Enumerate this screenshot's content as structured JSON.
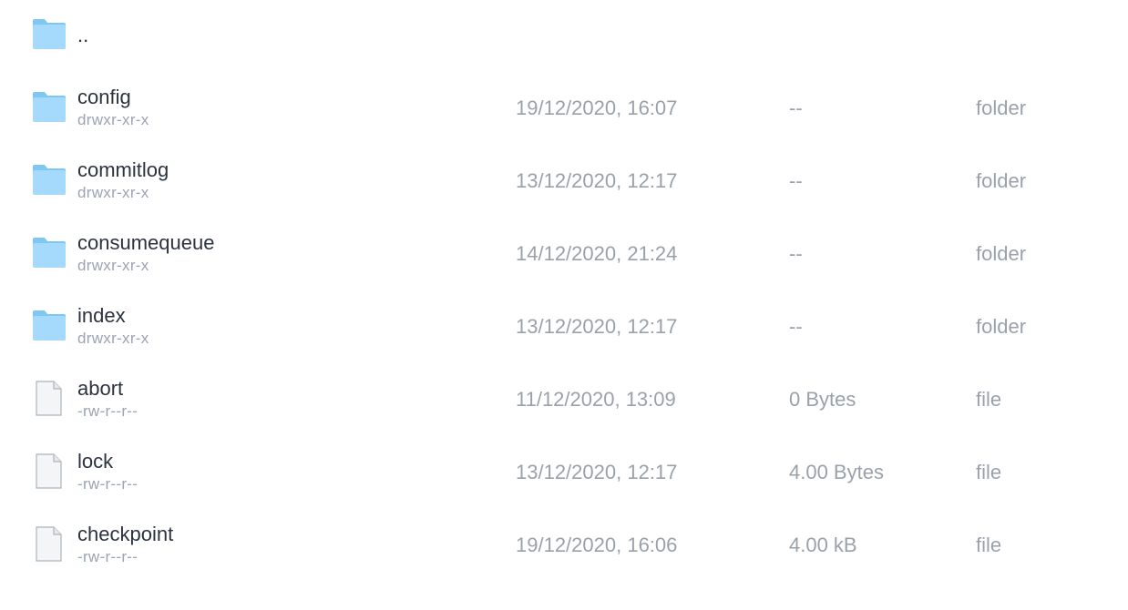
{
  "parent_row": {
    "name": "..",
    "icon": "folder-icon"
  },
  "entries": [
    {
      "name": "config",
      "permissions": "drwxr-xr-x",
      "modified": "19/12/2020, 16:07",
      "size": "--",
      "type": "folder",
      "icon": "folder-icon"
    },
    {
      "name": "commitlog",
      "permissions": "drwxr-xr-x",
      "modified": "13/12/2020, 12:17",
      "size": "--",
      "type": "folder",
      "icon": "folder-icon"
    },
    {
      "name": "consumequeue",
      "permissions": "drwxr-xr-x",
      "modified": "14/12/2020, 21:24",
      "size": "--",
      "type": "folder",
      "icon": "folder-icon"
    },
    {
      "name": "index",
      "permissions": "drwxr-xr-x",
      "modified": "13/12/2020, 12:17",
      "size": "--",
      "type": "folder",
      "icon": "folder-icon"
    },
    {
      "name": "abort",
      "permissions": "-rw-r--r--",
      "modified": "11/12/2020, 13:09",
      "size": "0 Bytes",
      "type": "file",
      "icon": "file-icon"
    },
    {
      "name": "lock",
      "permissions": "-rw-r--r--",
      "modified": "13/12/2020, 12:17",
      "size": "4.00 Bytes",
      "type": "file",
      "icon": "file-icon"
    },
    {
      "name": "checkpoint",
      "permissions": "-rw-r--r--",
      "modified": "19/12/2020, 16:06",
      "size": "4.00 kB",
      "type": "file",
      "icon": "file-icon"
    }
  ],
  "colors": {
    "folder_light": "#9fd6fb",
    "folder_dark": "#6cbcf2",
    "name_text": "#2b3340",
    "meta_text": "#9aa1ab",
    "perm_text": "#9aa4b2"
  }
}
